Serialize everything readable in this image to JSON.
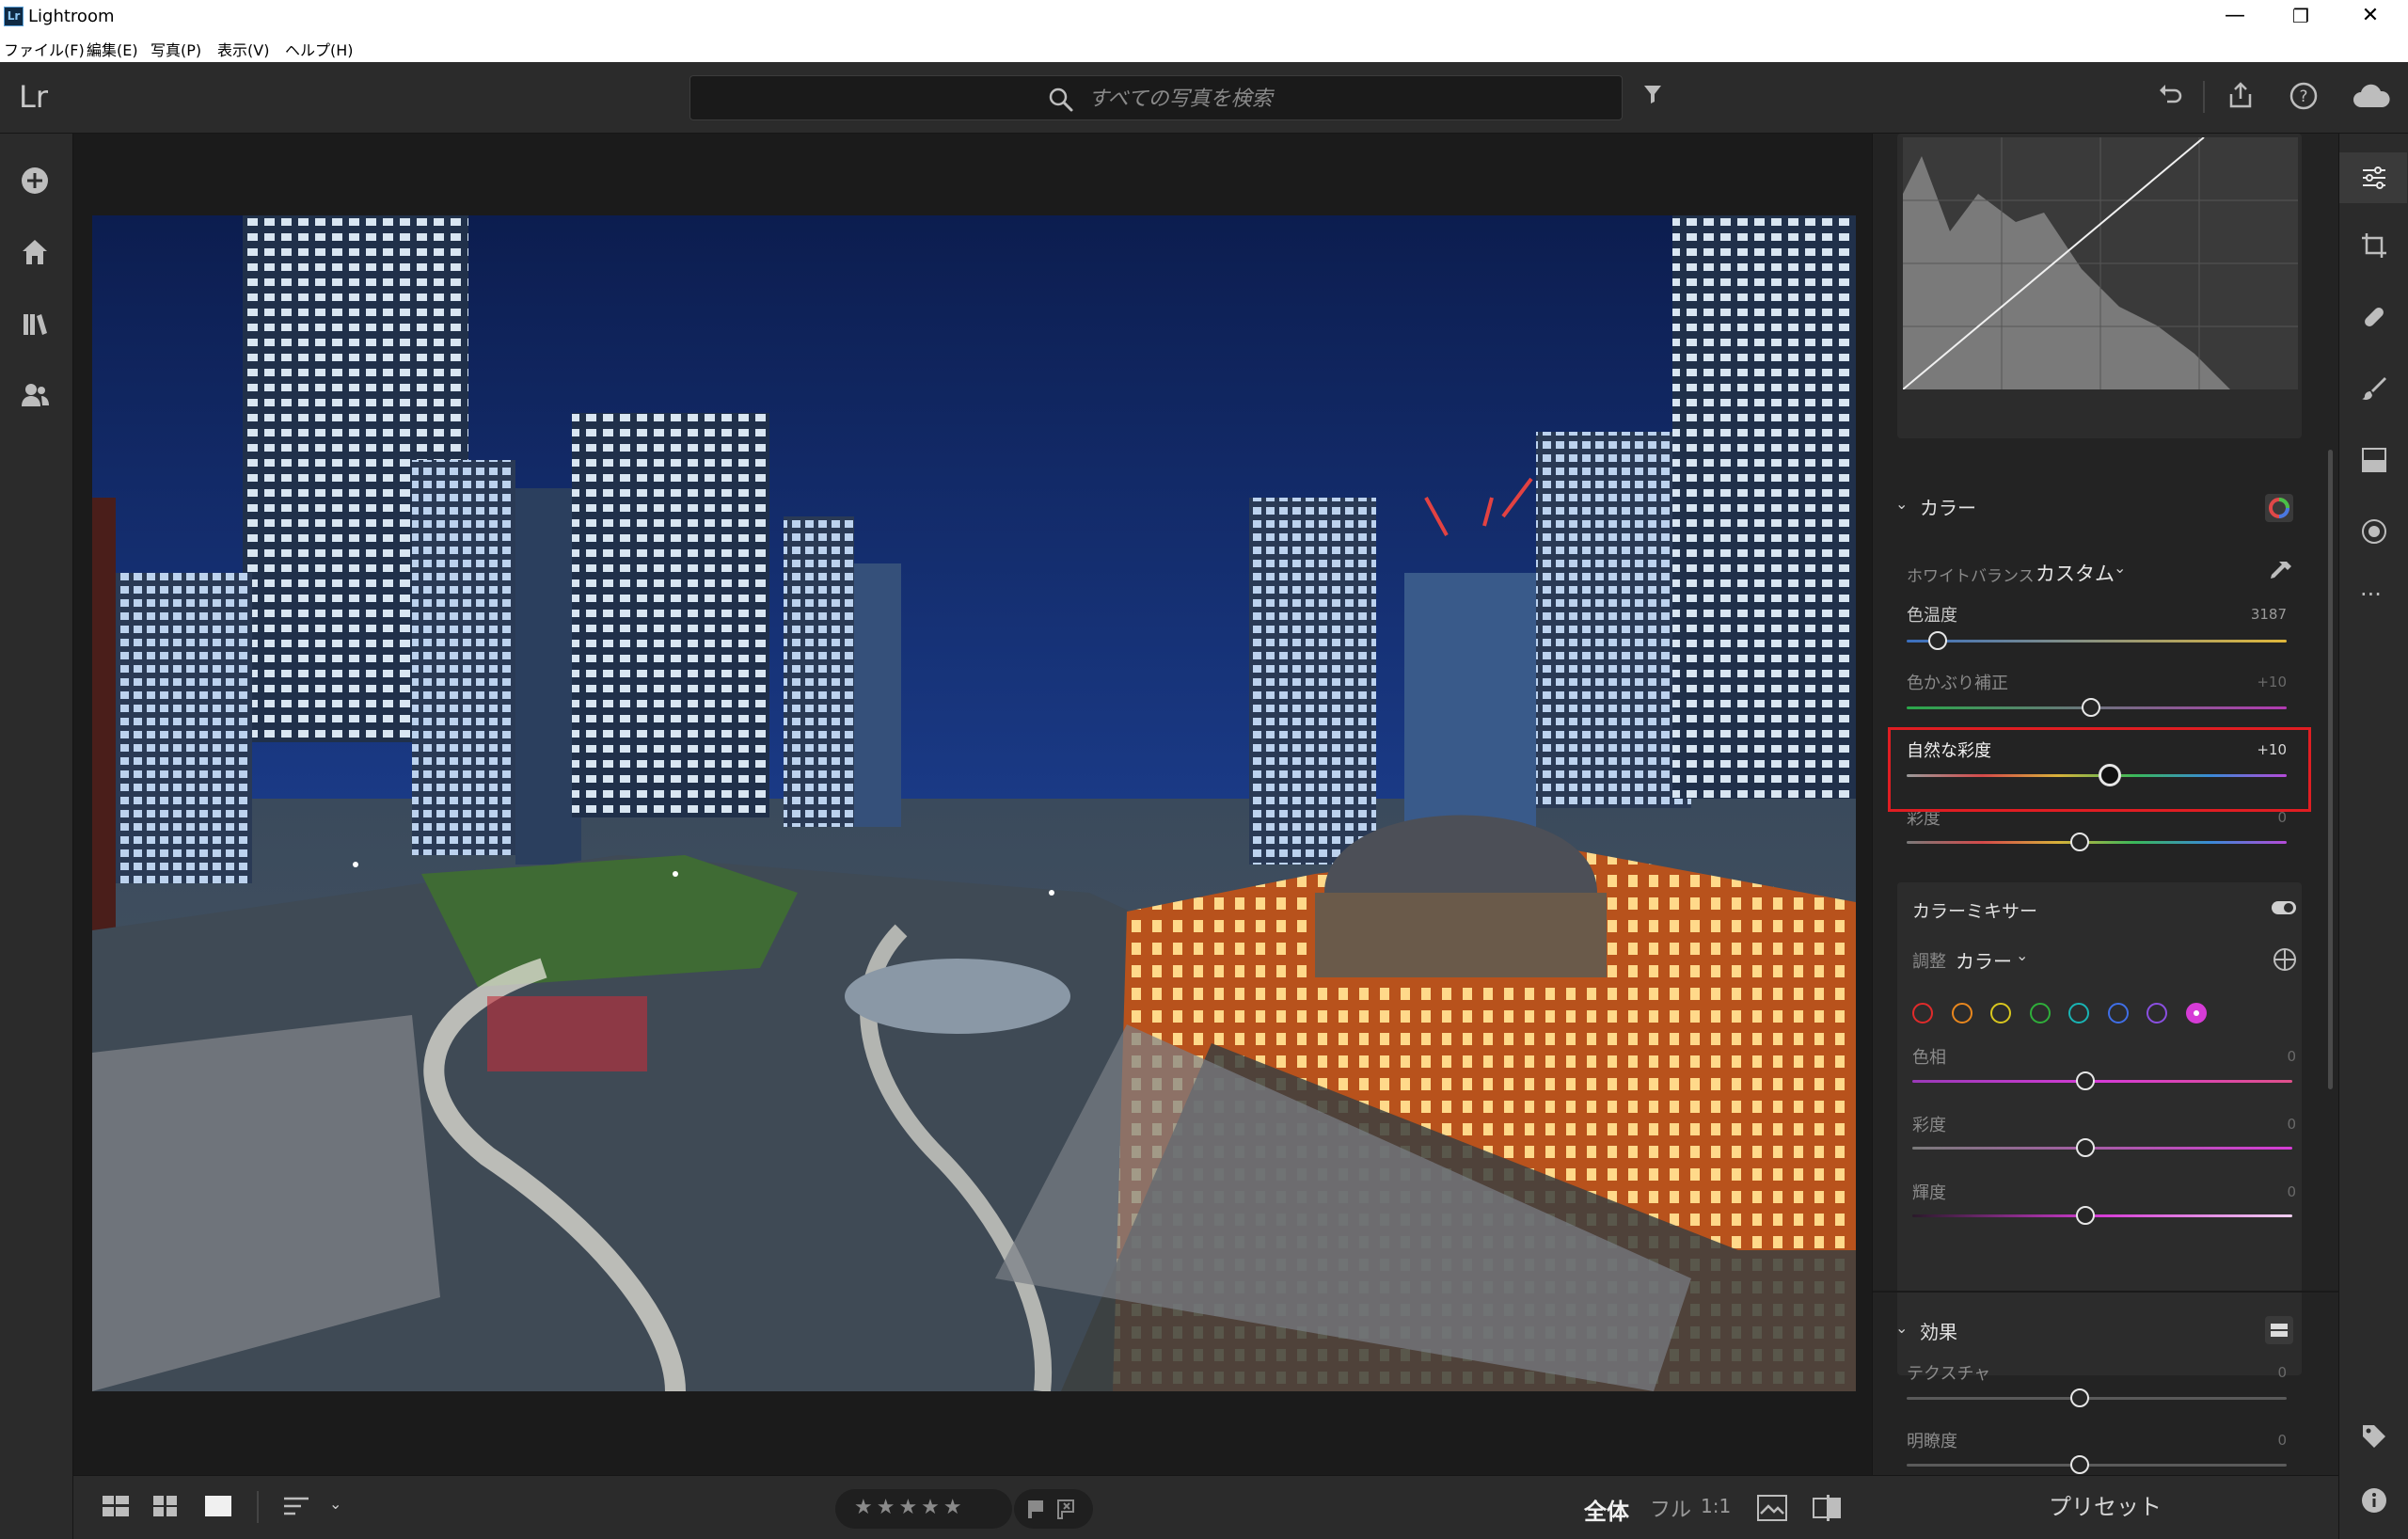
{
  "window": {
    "title": "Lightroom",
    "minimize": "—",
    "restore": "❐",
    "close": "✕"
  },
  "menu": [
    "ファイル(F)",
    "編集(E)",
    "写真(P)",
    "表示(V)",
    "ヘルプ(H)"
  ],
  "toolbar": {
    "logo": "Lr",
    "search_placeholder": "すべての写真を検索"
  },
  "colors": {
    "accent_highlight": "#e01d22",
    "panel_bg": "#232323",
    "section_bg": "#2c2c2c"
  },
  "right_panel": {
    "color_section": {
      "title": "カラー",
      "white_balance": {
        "label": "ホワイトバランス",
        "value": "カスタム"
      },
      "sliders": [
        {
          "label": "色温度",
          "value": "3187",
          "position": 0.07
        },
        {
          "label": "色かぶり補正",
          "value": "+10",
          "position": 0.53
        },
        {
          "label": "自然な彩度",
          "value": "+10",
          "position": 0.55
        },
        {
          "label": "彩度",
          "value": "0",
          "position": 0.5
        }
      ]
    },
    "color_mixer": {
      "title": "カラーミキサー",
      "adjust_label": "調整",
      "adjust_value": "カラー",
      "swatches": [
        "#e02b2b",
        "#e8871e",
        "#d9c61e",
        "#2fae3a",
        "#19b4b4",
        "#3f6ee6",
        "#8a4fe0",
        "#d63cd6"
      ],
      "selected_swatch": 7,
      "sliders": [
        {
          "label": "色相",
          "value": "0",
          "position": 0.5
        },
        {
          "label": "彩度",
          "value": "0",
          "position": 0.5
        },
        {
          "label": "輝度",
          "value": "0",
          "position": 0.5
        }
      ]
    },
    "effects_section": {
      "title": "効果",
      "sliders": [
        {
          "label": "テクスチャ",
          "value": "0",
          "position": 0.5
        },
        {
          "label": "明瞭度",
          "value": "0",
          "position": 0.5
        }
      ]
    }
  },
  "footer": {
    "stars": "★★★★★",
    "zoom_fit": "全体",
    "zoom_fill": "フル",
    "zoom_1to1": "1:1",
    "presets": "プリセット"
  }
}
